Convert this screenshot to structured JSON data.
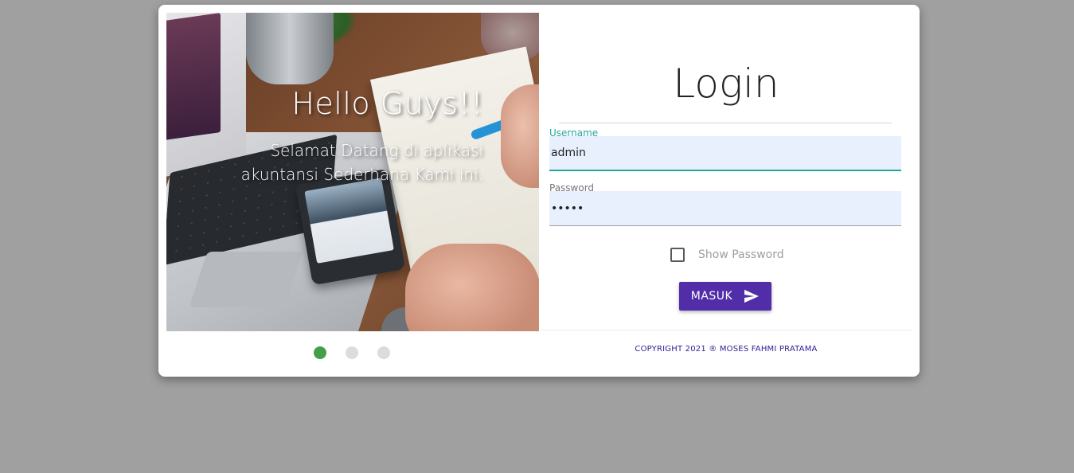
{
  "carousel": {
    "heading": "Hello Guys!!",
    "subtitle_line1": "Selamat Datang di aplikasi",
    "subtitle_line2": "akuntansi Sederhana Kami ini.",
    "slide_count": 3,
    "active_slide": 1
  },
  "login": {
    "title": "Login",
    "username": {
      "label": "Username",
      "value": "admin"
    },
    "password": {
      "label": "Password",
      "value": "admin"
    },
    "show_password_label": "Show Password",
    "show_password_checked": false,
    "submit_label": "MASUK",
    "submit_icon": "send-icon"
  },
  "footer": {
    "copyright": "COPYRIGHT 2021 ® MOSES FAHMI PRATAMA"
  },
  "colors": {
    "background": "#a0a0a0",
    "accent_button": "#512da8",
    "focus_teal": "#26a69a",
    "active_dot": "#43a047",
    "inactive_dot": "#dcdcdc",
    "copyright_text": "#311b92",
    "autofill_bg": "#e8f0fe"
  }
}
